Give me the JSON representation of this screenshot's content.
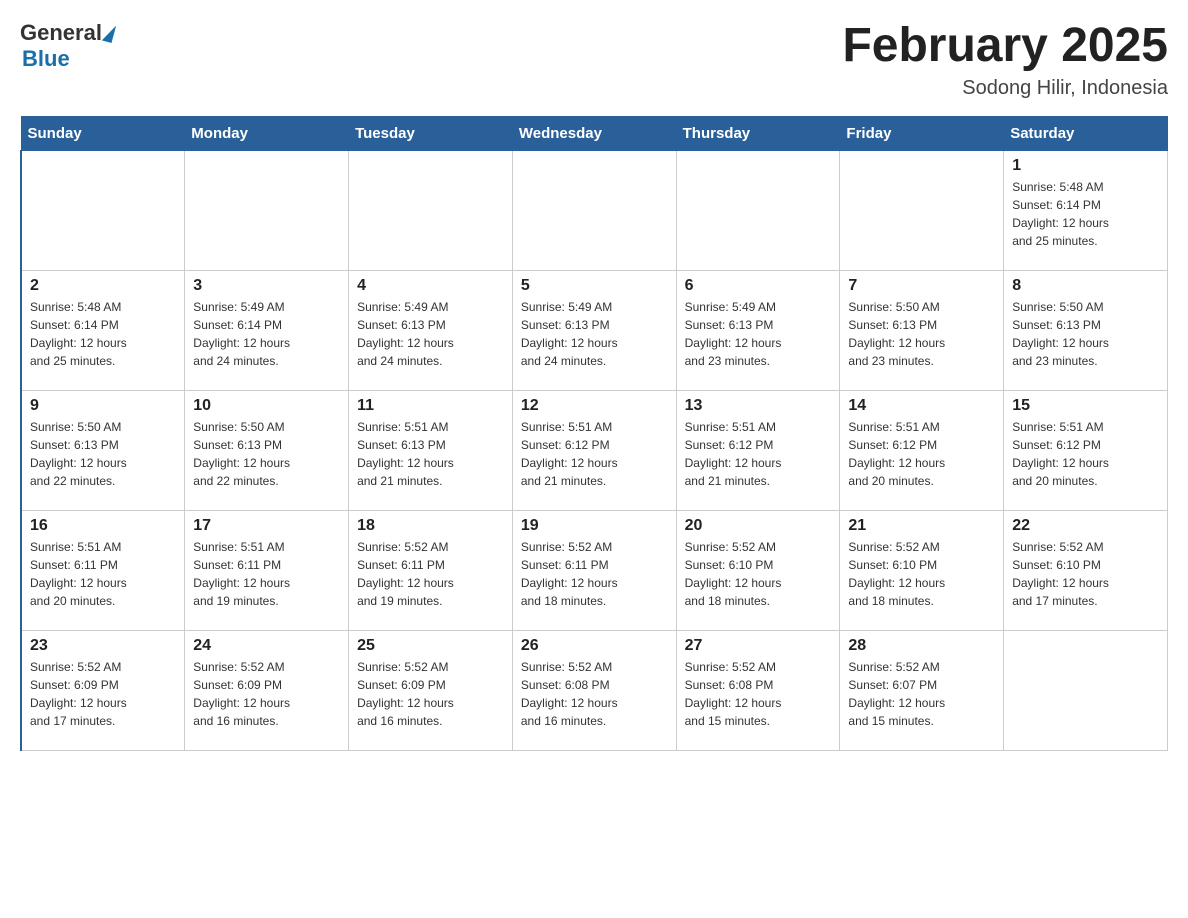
{
  "header": {
    "logo_general": "General",
    "logo_blue": "Blue",
    "month_title": "February 2025",
    "location": "Sodong Hilir, Indonesia"
  },
  "weekdays": [
    "Sunday",
    "Monday",
    "Tuesday",
    "Wednesday",
    "Thursday",
    "Friday",
    "Saturday"
  ],
  "weeks": [
    [
      {
        "day": "",
        "info": ""
      },
      {
        "day": "",
        "info": ""
      },
      {
        "day": "",
        "info": ""
      },
      {
        "day": "",
        "info": ""
      },
      {
        "day": "",
        "info": ""
      },
      {
        "day": "",
        "info": ""
      },
      {
        "day": "1",
        "info": "Sunrise: 5:48 AM\nSunset: 6:14 PM\nDaylight: 12 hours\nand 25 minutes."
      }
    ],
    [
      {
        "day": "2",
        "info": "Sunrise: 5:48 AM\nSunset: 6:14 PM\nDaylight: 12 hours\nand 25 minutes."
      },
      {
        "day": "3",
        "info": "Sunrise: 5:49 AM\nSunset: 6:14 PM\nDaylight: 12 hours\nand 24 minutes."
      },
      {
        "day": "4",
        "info": "Sunrise: 5:49 AM\nSunset: 6:13 PM\nDaylight: 12 hours\nand 24 minutes."
      },
      {
        "day": "5",
        "info": "Sunrise: 5:49 AM\nSunset: 6:13 PM\nDaylight: 12 hours\nand 24 minutes."
      },
      {
        "day": "6",
        "info": "Sunrise: 5:49 AM\nSunset: 6:13 PM\nDaylight: 12 hours\nand 23 minutes."
      },
      {
        "day": "7",
        "info": "Sunrise: 5:50 AM\nSunset: 6:13 PM\nDaylight: 12 hours\nand 23 minutes."
      },
      {
        "day": "8",
        "info": "Sunrise: 5:50 AM\nSunset: 6:13 PM\nDaylight: 12 hours\nand 23 minutes."
      }
    ],
    [
      {
        "day": "9",
        "info": "Sunrise: 5:50 AM\nSunset: 6:13 PM\nDaylight: 12 hours\nand 22 minutes."
      },
      {
        "day": "10",
        "info": "Sunrise: 5:50 AM\nSunset: 6:13 PM\nDaylight: 12 hours\nand 22 minutes."
      },
      {
        "day": "11",
        "info": "Sunrise: 5:51 AM\nSunset: 6:13 PM\nDaylight: 12 hours\nand 21 minutes."
      },
      {
        "day": "12",
        "info": "Sunrise: 5:51 AM\nSunset: 6:12 PM\nDaylight: 12 hours\nand 21 minutes."
      },
      {
        "day": "13",
        "info": "Sunrise: 5:51 AM\nSunset: 6:12 PM\nDaylight: 12 hours\nand 21 minutes."
      },
      {
        "day": "14",
        "info": "Sunrise: 5:51 AM\nSunset: 6:12 PM\nDaylight: 12 hours\nand 20 minutes."
      },
      {
        "day": "15",
        "info": "Sunrise: 5:51 AM\nSunset: 6:12 PM\nDaylight: 12 hours\nand 20 minutes."
      }
    ],
    [
      {
        "day": "16",
        "info": "Sunrise: 5:51 AM\nSunset: 6:11 PM\nDaylight: 12 hours\nand 20 minutes."
      },
      {
        "day": "17",
        "info": "Sunrise: 5:51 AM\nSunset: 6:11 PM\nDaylight: 12 hours\nand 19 minutes."
      },
      {
        "day": "18",
        "info": "Sunrise: 5:52 AM\nSunset: 6:11 PM\nDaylight: 12 hours\nand 19 minutes."
      },
      {
        "day": "19",
        "info": "Sunrise: 5:52 AM\nSunset: 6:11 PM\nDaylight: 12 hours\nand 18 minutes."
      },
      {
        "day": "20",
        "info": "Sunrise: 5:52 AM\nSunset: 6:10 PM\nDaylight: 12 hours\nand 18 minutes."
      },
      {
        "day": "21",
        "info": "Sunrise: 5:52 AM\nSunset: 6:10 PM\nDaylight: 12 hours\nand 18 minutes."
      },
      {
        "day": "22",
        "info": "Sunrise: 5:52 AM\nSunset: 6:10 PM\nDaylight: 12 hours\nand 17 minutes."
      }
    ],
    [
      {
        "day": "23",
        "info": "Sunrise: 5:52 AM\nSunset: 6:09 PM\nDaylight: 12 hours\nand 17 minutes."
      },
      {
        "day": "24",
        "info": "Sunrise: 5:52 AM\nSunset: 6:09 PM\nDaylight: 12 hours\nand 16 minutes."
      },
      {
        "day": "25",
        "info": "Sunrise: 5:52 AM\nSunset: 6:09 PM\nDaylight: 12 hours\nand 16 minutes."
      },
      {
        "day": "26",
        "info": "Sunrise: 5:52 AM\nSunset: 6:08 PM\nDaylight: 12 hours\nand 16 minutes."
      },
      {
        "day": "27",
        "info": "Sunrise: 5:52 AM\nSunset: 6:08 PM\nDaylight: 12 hours\nand 15 minutes."
      },
      {
        "day": "28",
        "info": "Sunrise: 5:52 AM\nSunset: 6:07 PM\nDaylight: 12 hours\nand 15 minutes."
      },
      {
        "day": "",
        "info": ""
      }
    ]
  ]
}
